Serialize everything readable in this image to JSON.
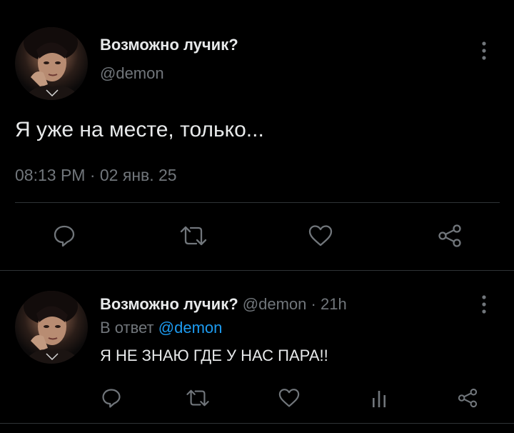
{
  "main_tweet": {
    "display_name": "Возможно лучик?",
    "handle": "@demon",
    "text": "Я уже на месте, только...",
    "timestamp": "08:13 PM · 02 янв. 25",
    "avatar": "user-avatar-photo",
    "actions": [
      "reply-icon",
      "retweet-icon",
      "like-icon",
      "share-icon"
    ]
  },
  "reply_tweet": {
    "display_name": "Возможно лучик?",
    "handle": "@demon",
    "separator": "·",
    "time": "21h",
    "reply_prefix": "В ответ",
    "reply_to": "@demon",
    "text": "Я НЕ ЗНАЮ ГДЕ У НАС ПАРА!!",
    "avatar": "user-avatar-photo",
    "actions": [
      "reply-icon",
      "retweet-icon",
      "like-icon",
      "stats-icon",
      "share-icon"
    ]
  },
  "colors": {
    "background": "#000000",
    "primary_text": "#e7e9ea",
    "secondary_text": "#71767b",
    "link": "#1d9bf0",
    "divider": "#2f3336"
  }
}
